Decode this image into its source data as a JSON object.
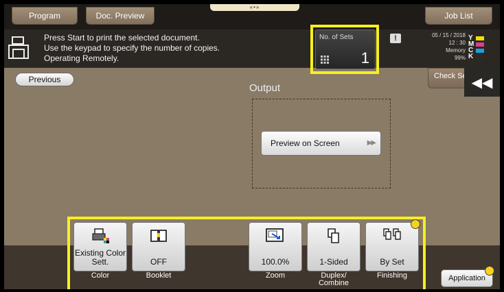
{
  "tabs": {
    "program": "Program",
    "doc_preview": "Doc. Preview",
    "job_list": "Job List",
    "center_handle": "«•»"
  },
  "message": {
    "line1": "Press Start to print the selected document.",
    "line2": "Use the keypad to specify the number of copies.",
    "line3": "Operating Remotely."
  },
  "sets": {
    "label": "No. of Sets",
    "value": "1"
  },
  "status": {
    "alert": "!",
    "date": "05 / 15 / 2018",
    "time": "12 : 30",
    "memory_label": "Memory",
    "memory_value": "99%",
    "toner": [
      {
        "letter": "Y",
        "color": "#f2e000"
      },
      {
        "letter": "M",
        "color": "#e23b8c"
      },
      {
        "letter": "C",
        "color": "#1aa0de"
      },
      {
        "letter": "K",
        "color": "#2a2a2a"
      }
    ]
  },
  "nav": {
    "previous": "Previous",
    "check": "Check Settings",
    "collapse": "◀◀"
  },
  "output": {
    "title": "Output",
    "preview_button": "Preview on Screen",
    "preview_arrow": "▶▶"
  },
  "functions": {
    "color": {
      "value": "Existing Color Sett.",
      "caption": "Color"
    },
    "booklet": {
      "value": "OFF",
      "caption": "Booklet"
    },
    "zoom": {
      "value": "100.0%",
      "caption": "Zoom"
    },
    "duplex": {
      "value": "1-Sided",
      "caption": "Duplex/ Combine"
    },
    "finishing": {
      "value": "By Set",
      "caption": "Finishing"
    }
  },
  "application": "Application",
  "colors": {
    "highlight": "#f6ef21",
    "background": "#8a7b67",
    "badge": "#f6d21f"
  }
}
